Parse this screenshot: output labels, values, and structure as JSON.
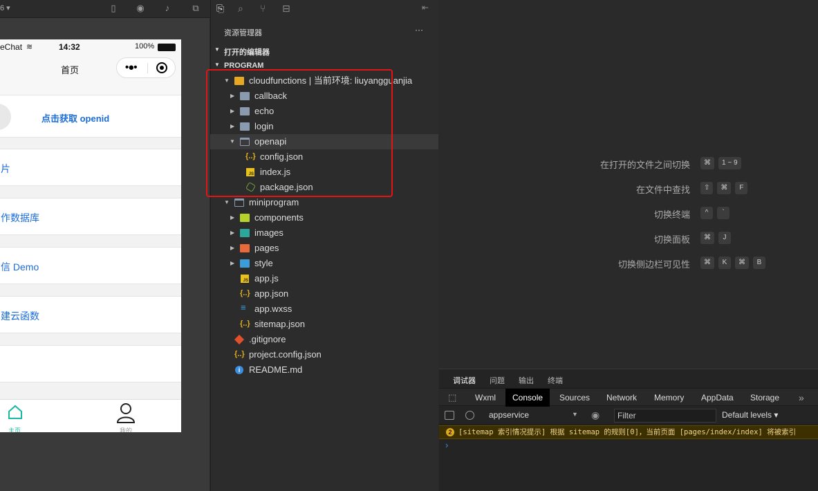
{
  "sim": {
    "top_left": "6 ▾",
    "status": {
      "carrier": "eChat",
      "time": "14:32",
      "battery": "100%"
    },
    "nav_title": "首页",
    "cards": [
      "点击获取 openid",
      "片",
      "作数据库",
      "信 Demo",
      "建云函数"
    ],
    "tabs": [
      {
        "label": "主页"
      },
      {
        "label": "我的"
      }
    ]
  },
  "explorer": {
    "title": "资源管理器",
    "more": "···",
    "open_editors": "打开的编辑器",
    "program": "PROGRAM",
    "tree": [
      {
        "label": "cloudfunctions | 当前环境: liuyangguanjia",
        "icon": "folder-open-yellow-icon"
      },
      {
        "label": "callback",
        "icon": "folder-icon"
      },
      {
        "label": "echo",
        "icon": "folder-icon"
      },
      {
        "label": "login",
        "icon": "folder-icon"
      },
      {
        "label": "openapi",
        "icon": "folder-open-icon"
      },
      {
        "label": "config.json",
        "icon": "json-icon"
      },
      {
        "label": "index.js",
        "icon": "js-icon"
      },
      {
        "label": "package.json",
        "icon": "node-icon"
      },
      {
        "label": "miniprogram",
        "icon": "folder-open-icon"
      },
      {
        "label": "components",
        "icon": "folder-icon"
      },
      {
        "label": "images",
        "icon": "folder-icon"
      },
      {
        "label": "pages",
        "icon": "folder-icon"
      },
      {
        "label": "style",
        "icon": "folder-icon"
      },
      {
        "label": "app.js",
        "icon": "js-icon"
      },
      {
        "label": "app.json",
        "icon": "json-icon"
      },
      {
        "label": "app.wxss",
        "icon": "css-icon"
      },
      {
        "label": "sitemap.json",
        "icon": "json-icon"
      },
      {
        "label": ".gitignore",
        "icon": "git-icon"
      },
      {
        "label": "project.config.json",
        "icon": "json-icon"
      },
      {
        "label": "README.md",
        "icon": "info-icon"
      }
    ]
  },
  "editor": {
    "shortcuts": [
      {
        "desc": "在打开的文件之间切换",
        "keys": [
          "⌘",
          "1 ~ 9"
        ]
      },
      {
        "desc": "在文件中查找",
        "keys": [
          "⇧",
          "⌘",
          "F"
        ]
      },
      {
        "desc": "切换终端",
        "keys": [
          "^",
          "`"
        ]
      },
      {
        "desc": "切换面板",
        "keys": [
          "⌘",
          "J"
        ]
      },
      {
        "desc": "切换侧边栏可见性",
        "keys": [
          "⌘",
          "K",
          "⌘",
          "B"
        ]
      }
    ]
  },
  "debugger": {
    "panel_tabs": [
      "调试器",
      "问题",
      "输出",
      "终端"
    ],
    "console_tabs": [
      "Wxml",
      "Console",
      "Sources",
      "Network",
      "Memory",
      "AppData",
      "Storage"
    ],
    "more": "»",
    "context": "appservice",
    "filter_placeholder": "Filter",
    "levels": "Default levels ▾",
    "warning_count": "2",
    "warning_text": "[sitemap 索引情况提示] 根据 sitemap 的规则[0]，当前页面 [pages/index/index] 将被索引",
    "prompt": "›"
  },
  "colors": {
    "highlight_box": "#e01515",
    "link_blue": "#1a6cd8",
    "tab_green": "#17b9a0"
  }
}
